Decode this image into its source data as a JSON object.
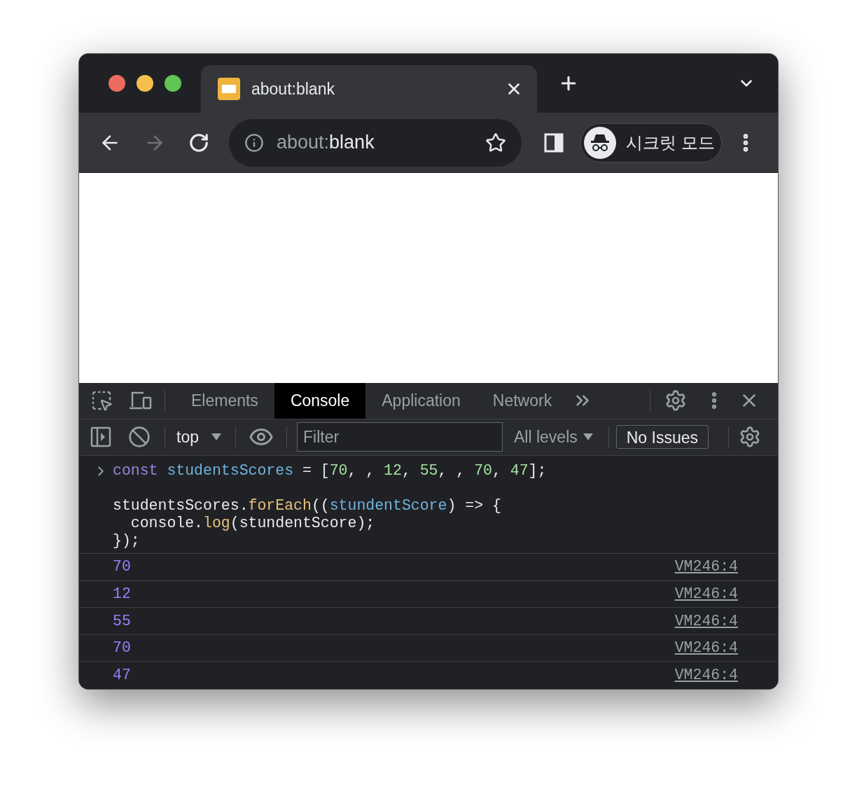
{
  "browser": {
    "tab_title": "about:blank",
    "address": {
      "scheme": "about:",
      "path": "blank"
    },
    "back_disabled": false,
    "forward_disabled": true,
    "profile_label": "시크릿 모드"
  },
  "devtools": {
    "tabs": [
      {
        "label": "Elements",
        "selected": false
      },
      {
        "label": "Console",
        "selected": true
      },
      {
        "label": "Application",
        "selected": false
      },
      {
        "label": "Network",
        "selected": false
      }
    ],
    "context": "top",
    "filter": {
      "placeholder": "Filter"
    },
    "levels": "All levels",
    "issues": "No Issues"
  },
  "console": {
    "statements": [
      [
        [
          {
            "kind": "keyword",
            "text": "const"
          },
          {
            "kind": "variable",
            "text": " studentsScores"
          },
          {
            "kind": "plain",
            "text": " = ["
          },
          {
            "kind": "number",
            "text": "70"
          },
          {
            "kind": "plain",
            "text": ", , "
          },
          {
            "kind": "number",
            "text": "12"
          },
          {
            "kind": "plain",
            "text": ", "
          },
          {
            "kind": "number",
            "text": "55"
          },
          {
            "kind": "plain",
            "text": ", , "
          },
          {
            "kind": "number",
            "text": "70"
          },
          {
            "kind": "plain",
            "text": ", "
          },
          {
            "kind": "number",
            "text": "47"
          },
          {
            "kind": "plain",
            "text": "];"
          }
        ]
      ],
      [
        [
          {
            "kind": "plain",
            "text": "studentsScores."
          },
          {
            "kind": "method",
            "text": "forEach"
          },
          {
            "kind": "plain",
            "text": "(("
          },
          {
            "kind": "variable",
            "text": "stundentScore"
          },
          {
            "kind": "plain",
            "text": ") => {"
          }
        ],
        [
          {
            "kind": "plain",
            "text": "  console."
          },
          {
            "kind": "method",
            "text": "log"
          },
          {
            "kind": "plain",
            "text": "(stundentScore);"
          }
        ],
        [
          {
            "kind": "plain",
            "text": "});"
          }
        ]
      ]
    ],
    "messages": [
      {
        "value": "70",
        "source": "VM246:4"
      },
      {
        "value": "12",
        "source": "VM246:4"
      },
      {
        "value": "55",
        "source": "VM246:4"
      },
      {
        "value": "70",
        "source": "VM246:4"
      },
      {
        "value": "47",
        "source": "VM246:4"
      }
    ]
  }
}
